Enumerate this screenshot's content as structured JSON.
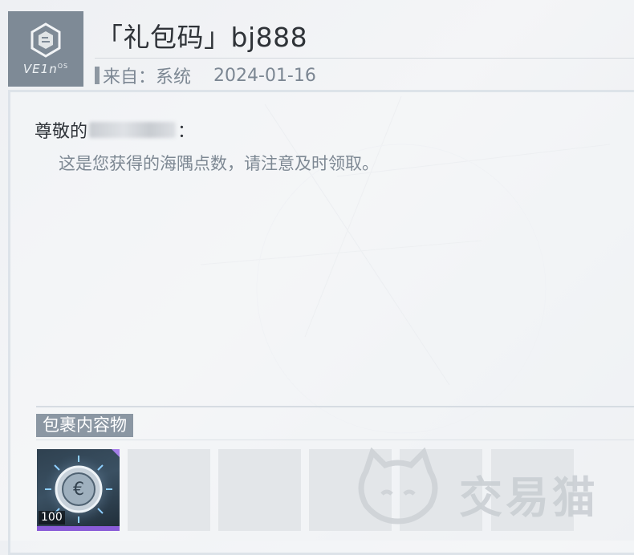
{
  "logo": {
    "text": "VE1n",
    "superscript": "OS"
  },
  "mail": {
    "title": "「礼包码」bj888",
    "from": "来自：系统",
    "date": "2024-01-16",
    "greeting_prefix": "尊敬的",
    "greeting_suffix": "：",
    "body": "这是您获得的海隅点数，请注意及时领取。"
  },
  "package": {
    "label": "包裹内容物",
    "items": [
      {
        "icon": "coin-currency-icon",
        "quantity": "100",
        "rarity_color": "#8a5cd8"
      }
    ],
    "empty_slots": 5
  },
  "watermark": {
    "text": "交易猫"
  }
}
